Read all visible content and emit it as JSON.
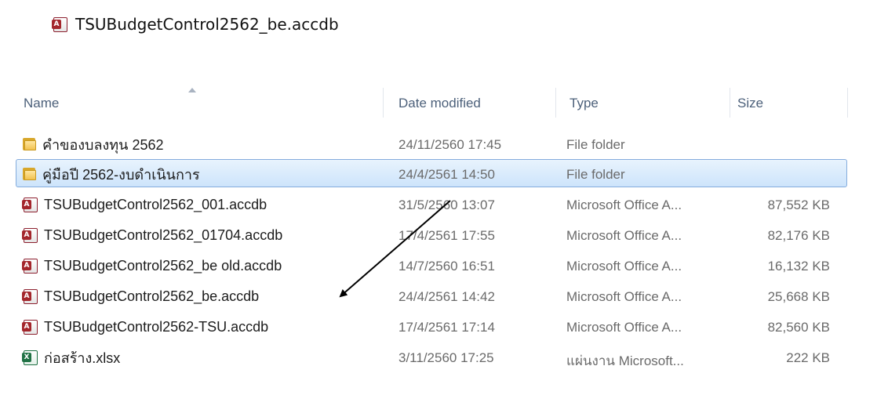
{
  "callout": {
    "file_name": "TSUBudgetControl2562_be.accdb",
    "icon": "access-file-icon"
  },
  "columns": {
    "name": "Name",
    "date_modified": "Date modified",
    "type": "Type",
    "size": "Size"
  },
  "files": [
    {
      "name": "คำของบลงทุน 2562",
      "date": "24/11/2560 17:45",
      "type": "File folder",
      "size": "",
      "icon": "folder-icon",
      "selected": false
    },
    {
      "name": "คู่มือปี 2562-งบดำเนินการ",
      "date": "24/4/2561 14:50",
      "type": "File folder",
      "size": "",
      "icon": "folder-icon",
      "selected": true
    },
    {
      "name": "TSUBudgetControl2562_001.accdb",
      "date": "31/5/2560 13:07",
      "type": "Microsoft Office A...",
      "size": "87,552 KB",
      "icon": "access-file-icon",
      "selected": false
    },
    {
      "name": "TSUBudgetControl2562_01704.accdb",
      "date": "17/4/2561 17:55",
      "type": "Microsoft Office A...",
      "size": "82,176 KB",
      "icon": "access-file-icon",
      "selected": false
    },
    {
      "name": "TSUBudgetControl2562_be old.accdb",
      "date": "14/7/2560 16:51",
      "type": "Microsoft Office A...",
      "size": "16,132 KB",
      "icon": "access-file-icon",
      "selected": false
    },
    {
      "name": "TSUBudgetControl2562_be.accdb",
      "date": "24/4/2561 14:42",
      "type": "Microsoft Office A...",
      "size": "25,668 KB",
      "icon": "access-file-icon",
      "selected": false
    },
    {
      "name": "TSUBudgetControl2562-TSU.accdb",
      "date": "17/4/2561 17:14",
      "type": "Microsoft Office A...",
      "size": "82,560 KB",
      "icon": "access-file-icon",
      "selected": false
    },
    {
      "name": "ก่อสร้าง.xlsx",
      "date": "3/11/2560 17:25",
      "type": "แผ่นงาน Microsoft...",
      "size": "222 KB",
      "icon": "excel-file-icon",
      "selected": false
    }
  ],
  "colors": {
    "selection_fill": "#cde4fb",
    "selection_border": "#84acdd",
    "header_text": "#4c607a",
    "arrow": "#000000"
  }
}
